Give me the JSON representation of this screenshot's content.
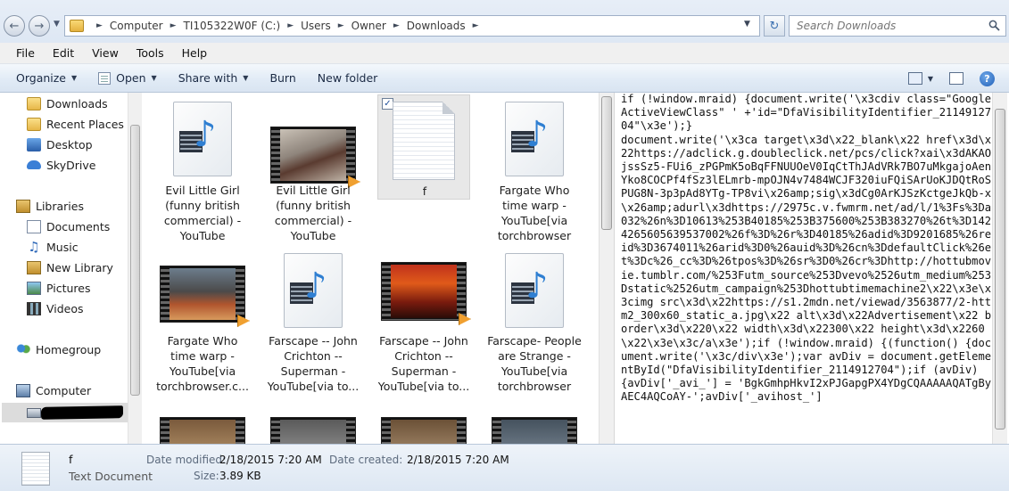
{
  "address": {
    "breadcrumbs": [
      "Computer",
      "TI105322W0F (C:)",
      "Users",
      "Owner",
      "Downloads"
    ]
  },
  "search": {
    "placeholder": "Search Downloads"
  },
  "menu": [
    "File",
    "Edit",
    "View",
    "Tools",
    "Help"
  ],
  "toolbar": {
    "organize": "Organize",
    "open": "Open",
    "share_with": "Share with",
    "burn": "Burn",
    "new_folder": "New folder"
  },
  "nav": {
    "favorites": [
      "Downloads",
      "Recent Places",
      "Desktop",
      "SkyDrive"
    ],
    "libraries_label": "Libraries",
    "libraries": [
      "Documents",
      "Music",
      "New Library",
      "Pictures",
      "Videos"
    ],
    "homegroup": "Homegroup",
    "computer": "Computer"
  },
  "files": [
    {
      "label": "Evil Little Girl (funny british commercial) - YouTube",
      "lines": [
        "Evil Little Girl",
        "(funny british",
        "commercial) -",
        "YouTube"
      ],
      "kind": "media-icon"
    },
    {
      "label": "Evil Little Girl (funny british commercial) - YouTube",
      "lines": [
        "Evil Little Girl",
        "(funny british",
        "commercial) -",
        "YouTube"
      ],
      "kind": "video"
    },
    {
      "label": "f",
      "lines": [
        "f"
      ],
      "kind": "text",
      "selected": true
    },
    {
      "label": "Fargate Who time warp - YouTube[via torchbrowser",
      "lines": [
        "Fargate Who",
        "time warp -",
        "YouTube[via",
        "torchbrowser"
      ],
      "kind": "media-icon"
    },
    {
      "label": "Fargate Who time warp - YouTube[via torchbrowser.c...",
      "lines": [
        "Fargate Who",
        "time warp -",
        "YouTube[via",
        "torchbrowser.c..."
      ],
      "kind": "video"
    },
    {
      "label": "Farscape -- John Crichton -- Superman - YouTube[via to...",
      "lines": [
        "Farscape -- John",
        "Crichton --",
        "Superman -",
        "YouTube[via to..."
      ],
      "kind": "media-icon"
    },
    {
      "label": "Farscape -- John Crichton -- Superman - YouTube[via to...",
      "lines": [
        "Farscape -- John",
        "Crichton --",
        "Superman -",
        "YouTube[via to..."
      ],
      "kind": "video"
    },
    {
      "label": "Farscape- People are Strange - YouTube[via torchbrowser",
      "lines": [
        "Farscape- People",
        "are Strange -",
        "YouTube[via",
        "torchbrowser"
      ],
      "kind": "media-icon"
    }
  ],
  "preview_text": "if (!window.mraid) {document.write('\\x3cdiv class=\"GoogleActiveViewClass\" ' +'id=\"DfaVisibilityIdentifier_2114912704\"\\x3e');}\ndocument.write('\\x3ca target\\x3d\\x22_blank\\x22 href\\x3d\\x22https://adclick.g.doubleclick.net/pcs/click?xai\\x3dAKAOjssSz5-FUi6_zPGPmK5oBqFFNUUOeV0IqCtThJAdVRk7BO7uMkgajoAenYko8COCPf4fSz3lELmrb-mpOJN4v7484WCJF320iuFQiSArUoKJDQtRoSPUG8N-3p3pAd8YTg-TP8vi\\x26amp;sig\\x3dCg0ArKJSzKctgeJkQb-x\\x26amp;adurl\\x3dhttps://2975c.v.fwmrm.net/ad/l/1%3Fs%3Da032%26n%3D10613%253B40185%253B375600%253B383270%26t%3D1424265605639537002%26f%3D%26r%3D40185%26adid%3D9201685%26reid%3D3674011%26arid%3D0%26auid%3D%26cn%3DdefaultClick%26et%3Dc%26_cc%3D%26tpos%3D%26sr%3D0%26cr%3Dhttp://hottubmovie.tumblr.com/%253Futm_source%253Dvevo%2526utm_medium%253Dstatic%2526utm_campaign%253Dhottubtimemachine2\\x22\\x3e\\x3cimg src\\x3d\\x22https://s1.2mdn.net/viewad/3563877/2-httm2_300x60_static_a.jpg\\x22 alt\\x3d\\x22Advertisement\\x22 border\\x3d\\x220\\x22 width\\x3d\\x22300\\x22 height\\x3d\\x2260\\x22\\x3e\\x3c/a\\x3e');if (!window.mraid) {(function() {document.write('\\x3c/div\\x3e');var avDiv = document.getElementById(\"DfaVisibilityIdentifier_2114912704\");if (avDiv) {avDiv['_avi_'] = 'BgkGmhpHkvI2xPJGapgPX4YDgCQAAAAAQATgByAEC4AQCoAY-';avDiv['_avihost_']",
  "details": {
    "name": "f",
    "type": "Text Document",
    "date_modified_label": "Date modified:",
    "date_modified": "2/18/2015 7:20 AM",
    "date_created_label": "Date created:",
    "date_created": "2/18/2015 7:20 AM",
    "size_label": "Size:",
    "size": "3.89 KB"
  },
  "icons": {
    "back": "back-arrow-icon",
    "forward": "forward-arrow-icon",
    "refresh": "refresh-icon",
    "search": "search-icon",
    "help": "help-icon"
  }
}
